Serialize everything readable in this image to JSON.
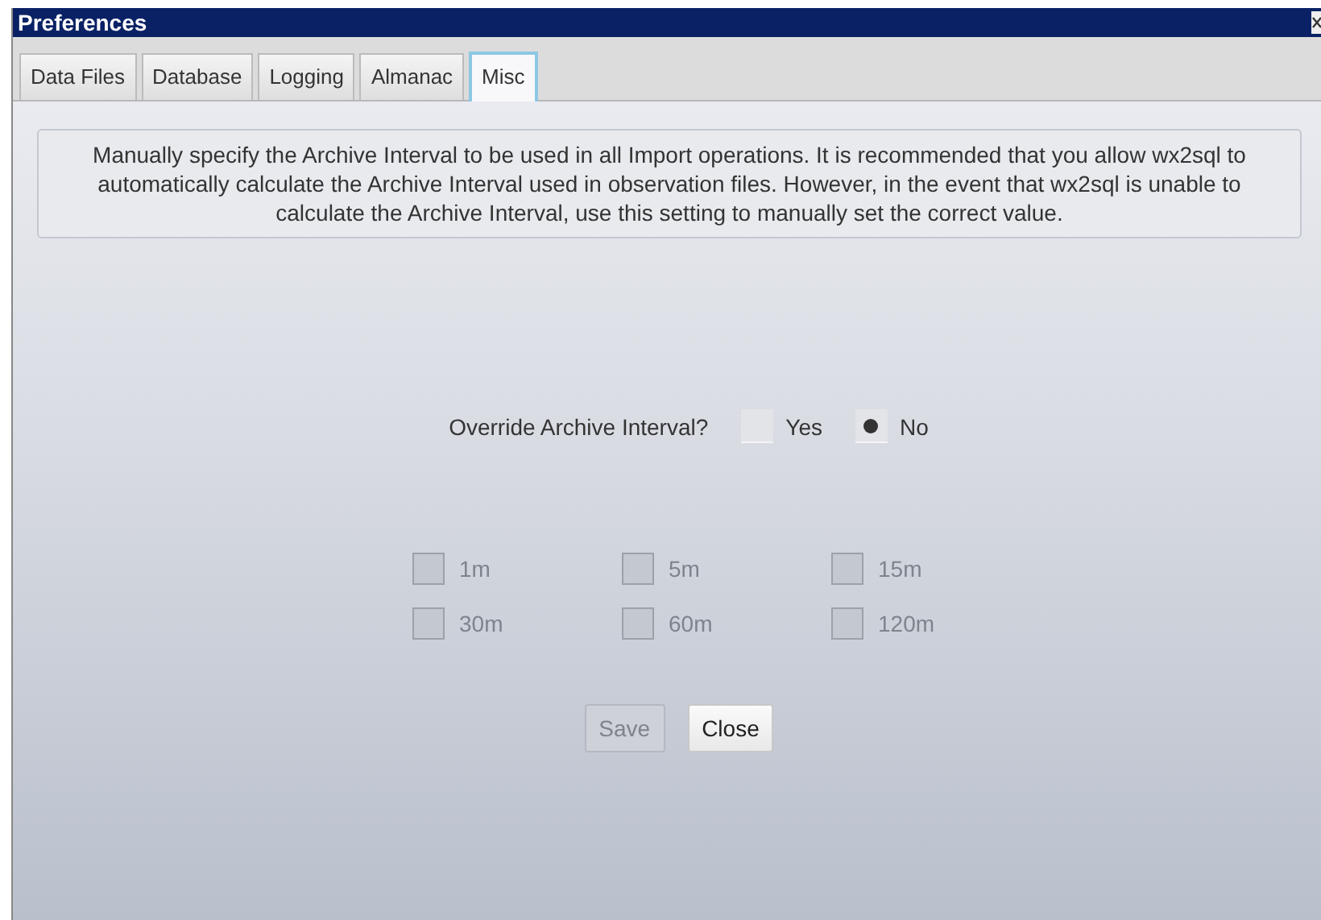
{
  "window": {
    "title": "Preferences"
  },
  "tabs": [
    {
      "label": "Data Files",
      "selected": false
    },
    {
      "label": "Database",
      "selected": false
    },
    {
      "label": "Logging",
      "selected": false
    },
    {
      "label": "Almanac",
      "selected": false
    },
    {
      "label": "Misc",
      "selected": true
    }
  ],
  "description": "Manually specify the Archive Interval to be used in all Import operations. It is recommended that you allow wx2sql to automatically calculate the Archive Interval used in observation files. However, in the event that wx2sql is unable to calculate the Archive Interval, use this setting to manually set the correct value.",
  "override": {
    "label": "Override Archive Interval?",
    "options": [
      {
        "label": "Yes",
        "selected": false
      },
      {
        "label": "No",
        "selected": true
      }
    ]
  },
  "intervals": [
    {
      "label": "1m",
      "checked": false,
      "disabled": true
    },
    {
      "label": "5m",
      "checked": false,
      "disabled": true
    },
    {
      "label": "15m",
      "checked": false,
      "disabled": true
    },
    {
      "label": "30m",
      "checked": false,
      "disabled": true
    },
    {
      "label": "60m",
      "checked": false,
      "disabled": true
    },
    {
      "label": "120m",
      "checked": false,
      "disabled": true
    }
  ],
  "buttons": [
    {
      "label": "Save",
      "disabled": true
    },
    {
      "label": "Close",
      "disabled": false
    }
  ]
}
